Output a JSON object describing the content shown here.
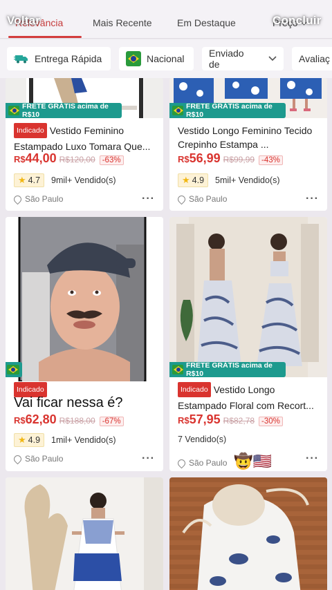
{
  "sort_bar": {
    "tabs": [
      {
        "label": "Relevância",
        "active": true
      },
      {
        "label": "Mais Recente"
      },
      {
        "label": "Em Destaque"
      },
      {
        "label": "Preço"
      }
    ],
    "overlay_left": "Voltar",
    "overlay_right": "Concluir"
  },
  "filters": [
    {
      "label": "Entrega Rápida",
      "icon": "truck-icon"
    },
    {
      "label": "Nacional",
      "icon": "brazil-flag-icon"
    },
    {
      "label": "Enviado de",
      "icon": "chevron-down-icon"
    },
    {
      "label": "Avaliaç"
    }
  ],
  "products": [
    {
      "free_shipping": "FRETE GRÁTIS acima de R$10",
      "tag": "Indicado",
      "title": "Vestido Feminino Estampado Luxo Tomara Que...",
      "currency": "R$",
      "price": "44,00",
      "old_price": "R$120,00",
      "discount": "-63%",
      "rating": "4.7",
      "sold": "9mil+ Vendido(s)",
      "location": "São Paulo"
    },
    {
      "free_shipping": "FRETE GRÁTIS acima de R$10",
      "title": "Vestido Longo Feminino Tecido Crepinho  Estampa ...",
      "currency": "R$",
      "price": "56,99",
      "old_price": "R$99,99",
      "discount": "-43%",
      "rating": "4.9",
      "sold": "5mil+ Vendido(s)",
      "location": "São Paulo"
    },
    {
      "tag": "Indicado",
      "caption": "Vai ficar nessa é?",
      "currency": "R$",
      "price": "62,80",
      "old_price": "R$188,00",
      "discount": "-67%",
      "rating": "4.9",
      "sold": "1mil+ Vendido(s)",
      "location": "São Paulo"
    },
    {
      "free_shipping": "FRETE GRÁTIS acima de R$10",
      "tag": "Indicado",
      "title": "Vestido Longo Estampado Floral com Recort...",
      "currency": "R$",
      "price": "57,95",
      "old_price": "R$82,78",
      "discount": "-30%",
      "sold": "7 Vendido(s)",
      "location": "São Paulo",
      "emoji": "🤠🇺🇸"
    }
  ],
  "colors": {
    "accent": "#d9342f",
    "free_shipping": "#1d9a8e",
    "background": "#ece8ee"
  }
}
